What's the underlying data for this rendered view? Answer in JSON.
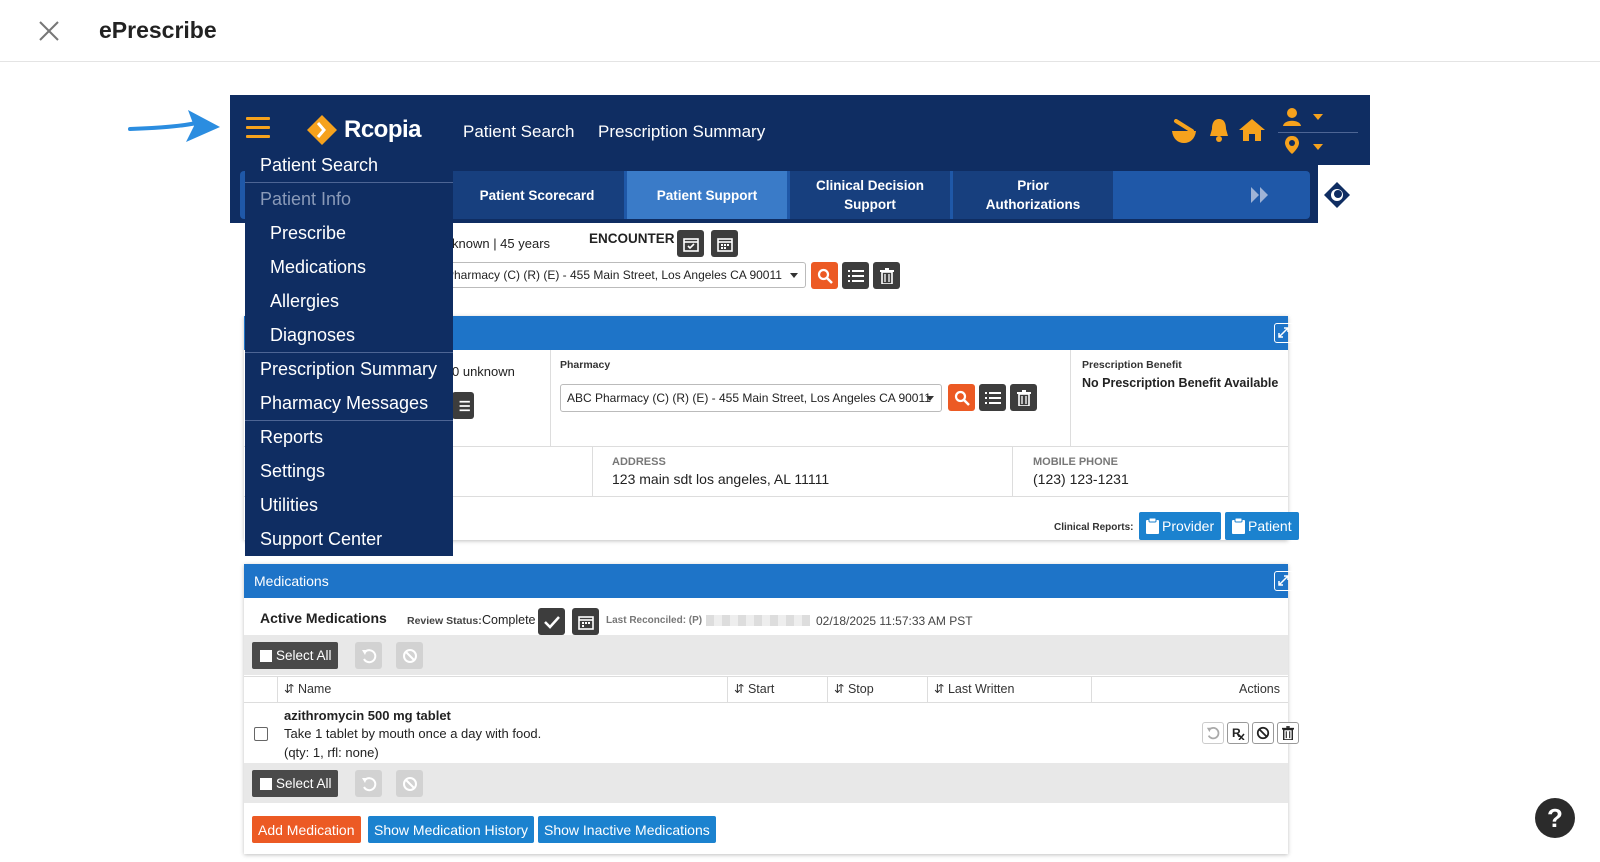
{
  "window": {
    "title": "ePrescribe"
  },
  "navbar": {
    "brand": "Rcopia",
    "links": [
      "Patient Search",
      "Prescription Summary"
    ]
  },
  "subtabs": [
    {
      "label": "Patient Scorecard",
      "active": false
    },
    {
      "label": "Patient Support",
      "active": true
    },
    {
      "label": "Clinical Decision Support",
      "active": false
    },
    {
      "label": "Prior Authorizations",
      "active": false
    }
  ],
  "encounter": {
    "patient_fragment": "known | 45 years",
    "label": "ENCOUNTER",
    "pharmacy_value": "Pharmacy (C) (R) (E) - 455 Main Street, Los Angeles CA 90011"
  },
  "patient_panel": {
    "age_fragment": "0 unknown",
    "pharmacy_label": "Pharmacy",
    "pharmacy_value": "ABC Pharmacy (C) (R) (E) - 455 Main Street, Los Angeles CA 90011",
    "benefit_label": "Prescription Benefit",
    "benefit_value": "No Prescription Benefit Available",
    "address_label": "ADDRESS",
    "address_value": "123 main sdt  los angeles, AL 11111",
    "phone_label": "MOBILE PHONE",
    "phone_value": "(123) 123-1231",
    "clinical_reports_label": "Clinical Reports:",
    "provider_btn": "Provider",
    "patient_btn": "Patient"
  },
  "medications": {
    "title": "Medications",
    "active_label": "Active Medications",
    "review_label": "Review Status:",
    "review_value": "Complete",
    "reconciled_label": "Last Reconciled: (P)",
    "reconciled_value": "02/18/2025 11:57:33 AM PST",
    "select_all": "Select All",
    "columns": [
      "Name",
      "Start",
      "Stop",
      "Last Written",
      "Actions"
    ],
    "rows": [
      {
        "name": "azithromycin 500 mg tablet",
        "sig": "Take 1 tablet by mouth once a day with food.",
        "qty": "(qty: 1, rfl: none)"
      }
    ],
    "buttons": {
      "add": "Add Medication",
      "history": "Show Medication History",
      "inactive": "Show Inactive Medications"
    }
  },
  "side_menu": [
    {
      "label": "Patient Search",
      "type": "main"
    },
    {
      "label": "Patient Info",
      "type": "disabled"
    },
    {
      "label": "Prescribe",
      "type": "sub"
    },
    {
      "label": "Medications",
      "type": "sub"
    },
    {
      "label": "Allergies",
      "type": "sub"
    },
    {
      "label": "Diagnoses",
      "type": "sub"
    },
    {
      "label": "Prescription Summary",
      "type": "main"
    },
    {
      "label": "Pharmacy Messages",
      "type": "main"
    },
    {
      "label": "Reports",
      "type": "main"
    },
    {
      "label": "Settings",
      "type": "main"
    },
    {
      "label": "Utilities",
      "type": "main"
    },
    {
      "label": "Support Center",
      "type": "main"
    }
  ],
  "help": {
    "label": "?"
  },
  "colors": {
    "navy": "#0f2d62",
    "orange": "#f6a21d",
    "blue": "#1e74c8",
    "red_orange": "#ec5a24"
  }
}
